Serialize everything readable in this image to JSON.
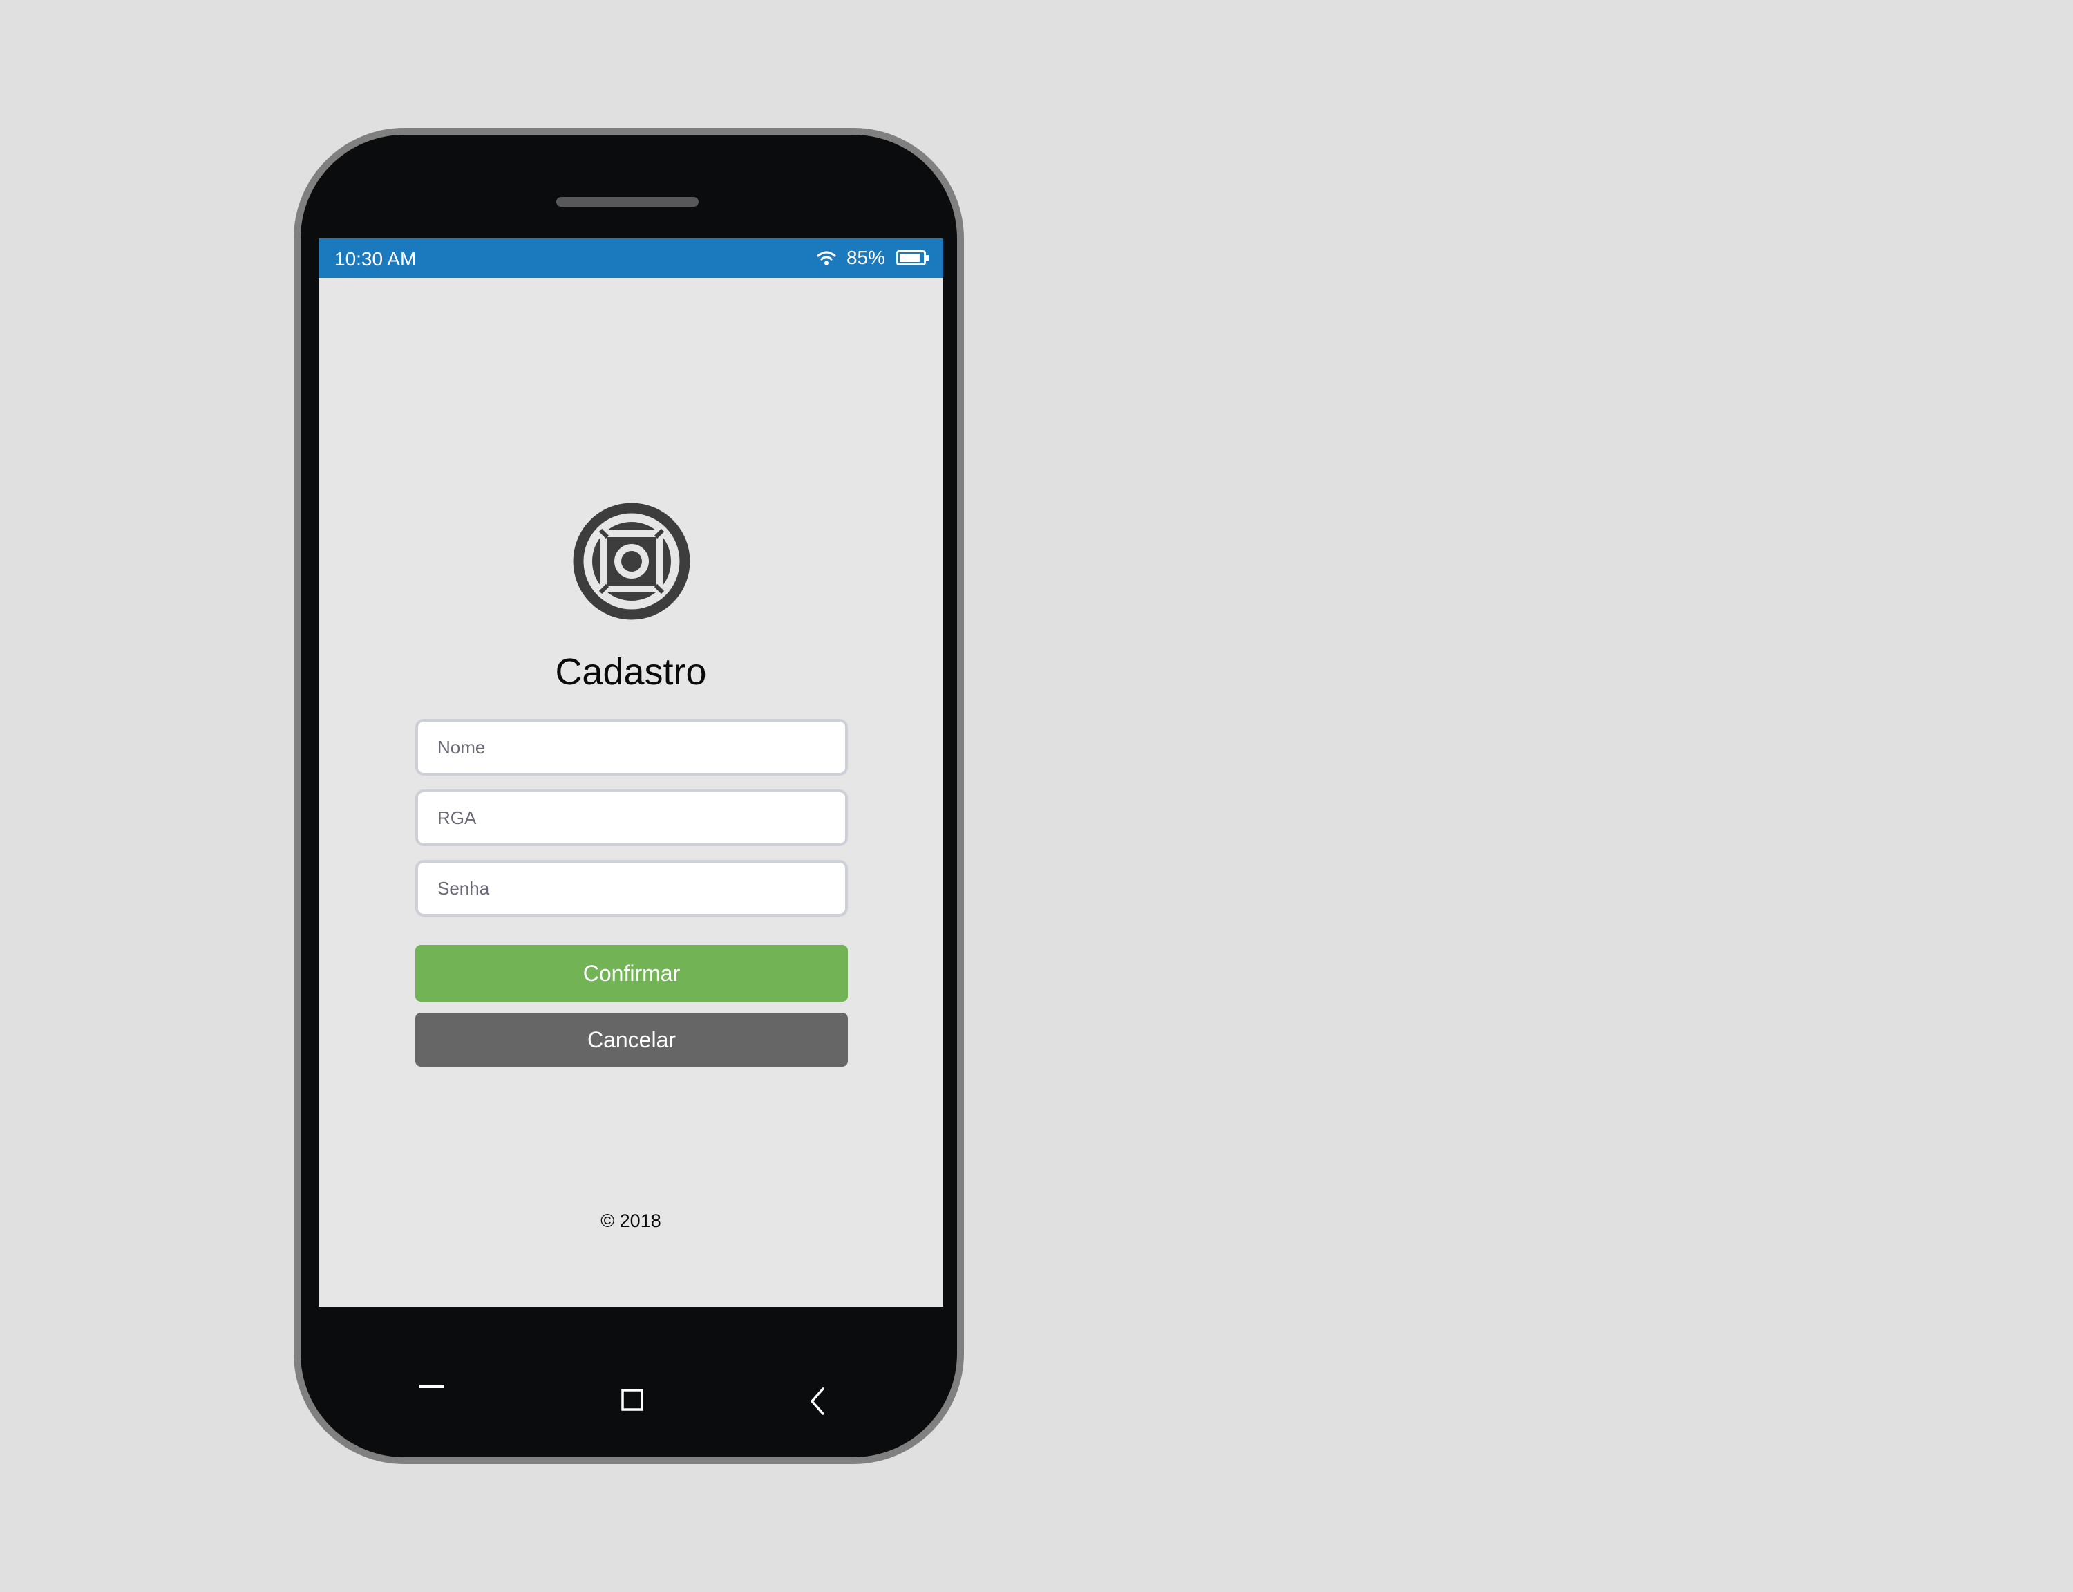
{
  "status_bar": {
    "time": "10:30 AM",
    "battery_percent": "85%",
    "battery_level": 0.85,
    "wifi_icon": "wifi-icon",
    "battery_icon": "battery-icon",
    "color": "#1b79be"
  },
  "logo": {
    "icon": "circular-square-logo-icon"
  },
  "form": {
    "title": "Cadastro",
    "fields": [
      {
        "name": "nome",
        "placeholder": "Nome",
        "value": ""
      },
      {
        "name": "rga",
        "placeholder": "RGA",
        "value": ""
      },
      {
        "name": "senha",
        "placeholder": "Senha",
        "value": ""
      }
    ],
    "confirm_label": "Confirmar",
    "cancel_label": "Cancelar",
    "confirm_color": "#72b356",
    "cancel_color": "#666666"
  },
  "footer": {
    "copyright": "© 2018"
  },
  "nav_bar": {
    "icons": [
      "menu-icon",
      "home-square-icon",
      "back-chevron-icon"
    ]
  }
}
